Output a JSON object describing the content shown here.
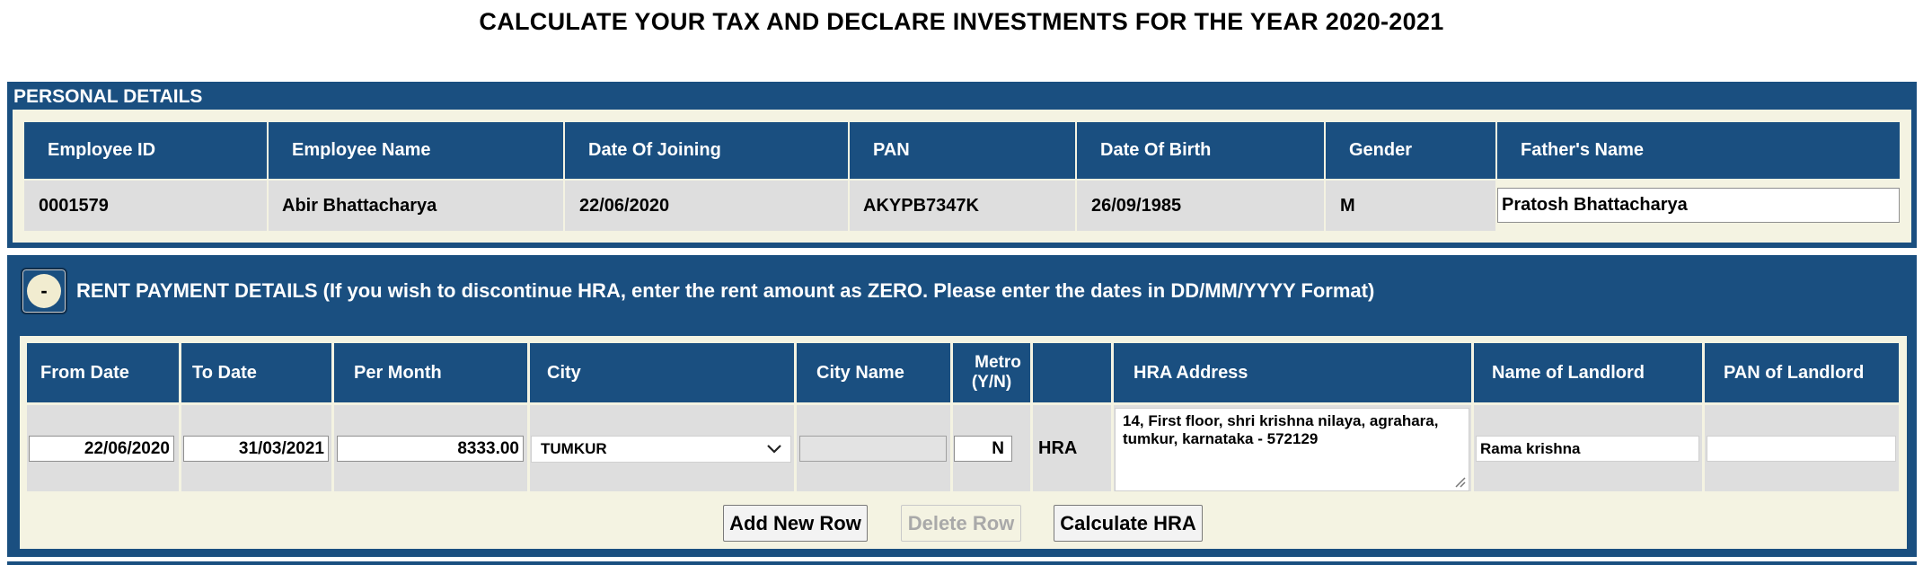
{
  "page_title": "CALCULATE YOUR TAX AND DECLARE INVESTMENTS FOR THE YEAR 2020-2021",
  "personal": {
    "title": "PERSONAL DETAILS",
    "headers": [
      "Employee ID",
      "Employee Name",
      "Date Of Joining",
      "PAN",
      "Date Of Birth",
      "Gender",
      "Father's Name"
    ],
    "values": {
      "employee_id": "0001579",
      "employee_name": "Abir Bhattacharya",
      "date_of_joining": "22/06/2020",
      "pan": "AKYPB7347K",
      "date_of_birth": "26/09/1985",
      "gender": "M",
      "fathers_name": "Pratosh Bhattacharya"
    }
  },
  "rent": {
    "toggle_label": "-",
    "title": "RENT PAYMENT DETAILS (If you wish to discontinue HRA, enter the rent amount as ZERO. Please enter the dates in DD/MM/YYYY Format)",
    "headers": {
      "from_date": "From Date",
      "to_date": "To Date",
      "per_month": "Per Month",
      "city": "City",
      "city_name": "City Name",
      "metro_line1": "Metro",
      "metro_line2": "(Y/N)",
      "hra_address": "HRA Address",
      "landlord_name": "Name of Landlord",
      "landlord_pan": "PAN of Landlord"
    },
    "row": {
      "from_date": "22/06/2020",
      "to_date": "31/03/2021",
      "per_month": "8333.00",
      "city": "TUMKUR",
      "city_name": "",
      "metro": "N",
      "hra_label": "HRA",
      "hra_address": "14, First floor, shri krishna nilaya, agrahara, tumkur, karnataka - 572129",
      "landlord_name": "Rama krishna",
      "landlord_pan": ""
    },
    "buttons": {
      "add": "Add New Row",
      "delete": "Delete Row",
      "calculate": "Calculate HRA"
    }
  }
}
